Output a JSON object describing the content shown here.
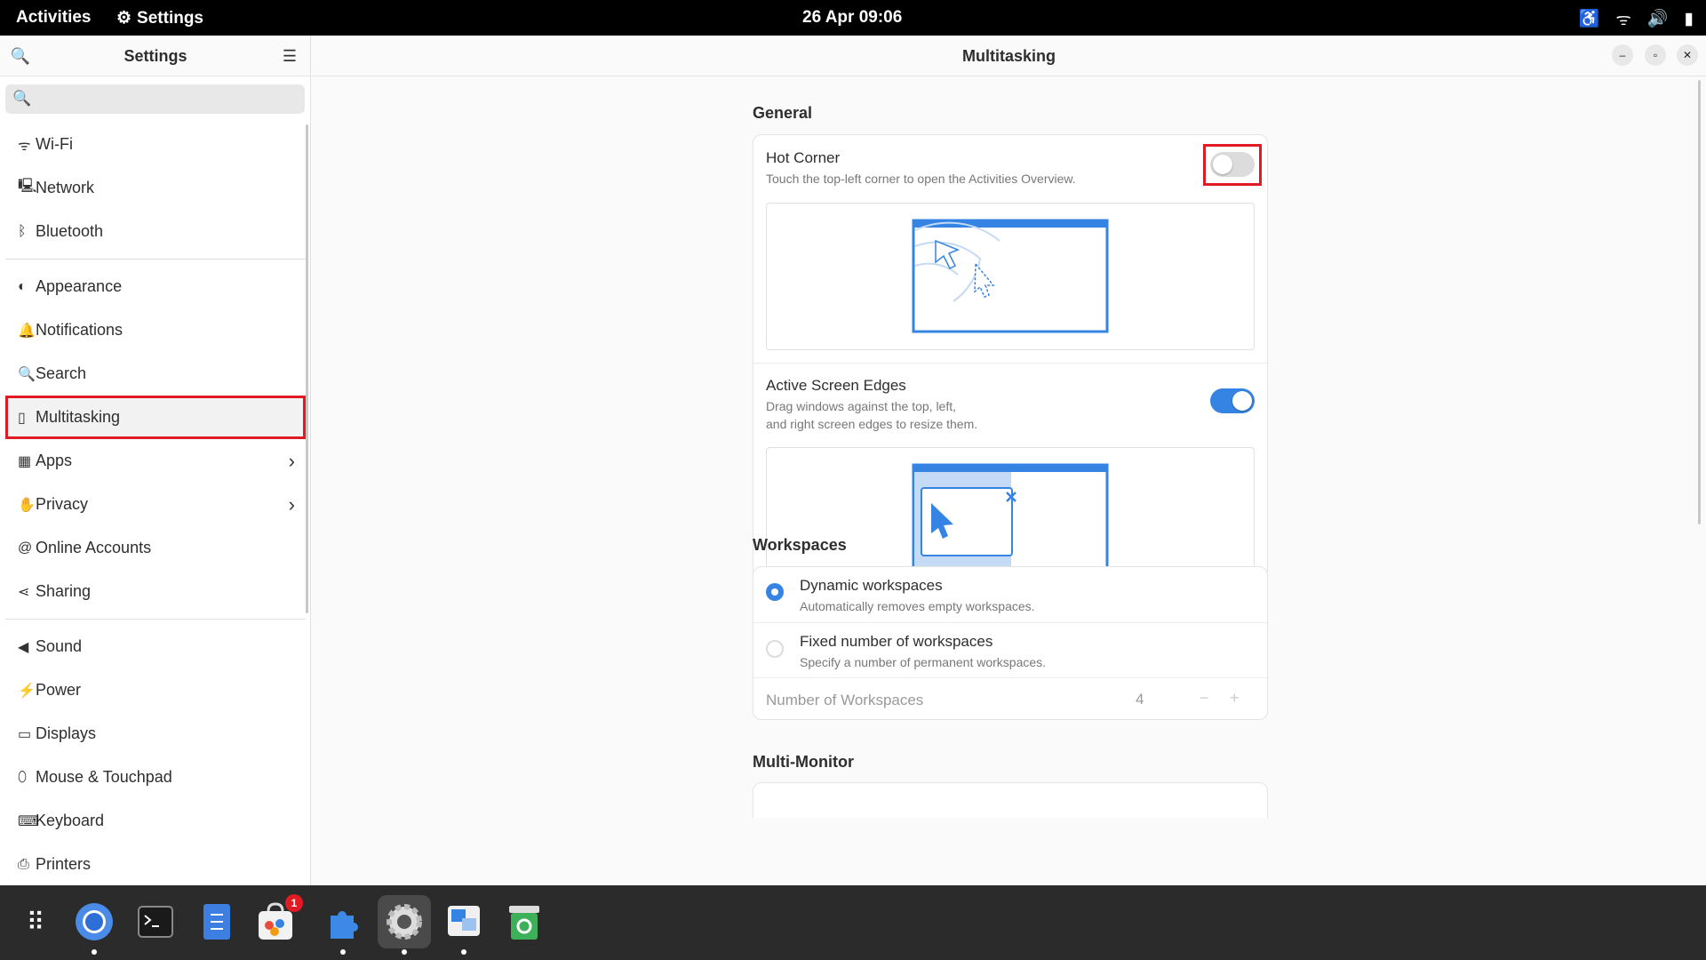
{
  "topbar": {
    "activities": "Activities",
    "app_name": "Settings",
    "app_icon": "gear-icon",
    "clock": "26 Apr  09:06",
    "tray": [
      "accessibility-icon",
      "wifi-icon",
      "volume-icon",
      "battery-icon"
    ]
  },
  "sidebar": {
    "title": "Settings",
    "search_placeholder": "",
    "items": [
      {
        "label": "Wi-Fi",
        "icon": "wifi-icon",
        "glyph": "ᯤ"
      },
      {
        "label": "Network",
        "icon": "network-icon",
        "glyph": "🖳"
      },
      {
        "label": "Bluetooth",
        "icon": "bluetooth-icon",
        "glyph": "ᛒ"
      },
      {
        "label": "Appearance",
        "icon": "appearance-icon",
        "glyph": "◐"
      },
      {
        "label": "Notifications",
        "icon": "bell-icon",
        "glyph": "🔔"
      },
      {
        "label": "Search",
        "icon": "search-icon",
        "glyph": "🔍"
      },
      {
        "label": "Multitasking",
        "icon": "multitasking-icon",
        "glyph": "▯"
      },
      {
        "label": "Apps",
        "icon": "apps-icon",
        "glyph": "▦"
      },
      {
        "label": "Privacy",
        "icon": "hand-icon",
        "glyph": "✋"
      },
      {
        "label": "Online Accounts",
        "icon": "at-icon",
        "glyph": "@"
      },
      {
        "label": "Sharing",
        "icon": "share-icon",
        "glyph": "⋖"
      },
      {
        "label": "Sound",
        "icon": "speaker-icon",
        "glyph": "◀"
      },
      {
        "label": "Power",
        "icon": "power-icon",
        "glyph": "⚡"
      },
      {
        "label": "Displays",
        "icon": "display-icon",
        "glyph": "▭"
      },
      {
        "label": "Mouse & Touchpad",
        "icon": "mouse-icon",
        "glyph": "⬯"
      },
      {
        "label": "Keyboard",
        "icon": "keyboard-icon",
        "glyph": "⌨"
      },
      {
        "label": "Printers",
        "icon": "printer-icon",
        "glyph": "⎙"
      }
    ]
  },
  "main": {
    "title": "Multitasking",
    "general": {
      "heading": "General",
      "hot_corner": {
        "title": "Hot Corner",
        "subtitle": "Touch the top-left corner to open the Activities Overview.",
        "enabled": false
      },
      "active_edges": {
        "title": "Active Screen Edges",
        "subtitle_line1": "Drag windows against the top, left,",
        "subtitle_line2": "and right screen edges to resize them.",
        "enabled": true
      }
    },
    "workspaces": {
      "heading": "Workspaces",
      "dynamic": {
        "title": "Dynamic workspaces",
        "subtitle": "Automatically removes empty workspaces.",
        "selected": true
      },
      "fixed": {
        "title": "Fixed number of workspaces",
        "subtitle": "Specify a number of permanent workspaces.",
        "selected": false
      },
      "number_label": "Number of Workspaces",
      "number_value": "4",
      "minus": "−",
      "plus": "+"
    },
    "multi_monitor": {
      "heading": "Multi-Monitor"
    }
  },
  "dock": {
    "items": [
      "app-grid-icon",
      "chromium-icon",
      "terminal-icon",
      "text-editor-icon",
      "software-store-icon",
      "extensions-icon",
      "settings-icon",
      "remote-desktop-icon",
      "trash-icon"
    ],
    "store_badge": "1"
  },
  "colors": {
    "accent": "#3584e4",
    "highlight": "#e01b24"
  }
}
